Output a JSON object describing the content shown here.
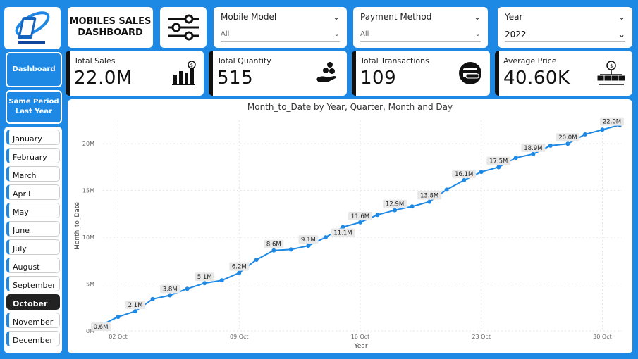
{
  "title": {
    "line1": "MOBILES SALES",
    "line2": "DASHBOARD"
  },
  "filters": [
    {
      "label": "Mobile Model",
      "value": "All"
    },
    {
      "label": "Payment Method",
      "value": "All"
    },
    {
      "label": "Year",
      "value": "2022"
    }
  ],
  "nav": {
    "dashboard": "Dashboard",
    "same_period_1": "Same Period",
    "same_period_2": "Last Year"
  },
  "kpis": [
    {
      "label": "Total Sales",
      "value": "22.0M",
      "icon": "bar-chart-dollar-icon"
    },
    {
      "label": "Total Quantity",
      "value": "515",
      "icon": "hand-coins-icon"
    },
    {
      "label": "Total Transactions",
      "value": "109",
      "icon": "card-payment-icon"
    },
    {
      "label": "Average Price",
      "value": "40.60K",
      "icon": "money-network-icon"
    }
  ],
  "months": [
    "January",
    "February",
    "March",
    "April",
    "May",
    "June",
    "July",
    "August",
    "September",
    "October",
    "November",
    "December"
  ],
  "selected_month": "October",
  "colors": {
    "accent": "#1E88E5",
    "line": "#1E88E5",
    "selected": "#222222"
  },
  "chart_data": {
    "type": "line",
    "title": "Month_to_Date by Year, Quarter, Month and Day",
    "xlabel": "Year",
    "ylabel": "Month_to_Date",
    "x_ticks": [
      "02 Oct",
      "09 Oct",
      "16 Oct",
      "23 Oct",
      "30 Oct"
    ],
    "y_ticks": [
      "0M",
      "5M",
      "10M",
      "15M",
      "20M"
    ],
    "ylim": [
      0,
      22.5
    ],
    "x_range": [
      "01 Oct",
      "31 Oct"
    ],
    "grid": true,
    "series": [
      {
        "days": [
          1,
          2,
          3,
          4,
          5,
          6,
          7,
          8,
          9,
          10,
          11,
          12,
          13,
          14,
          15,
          16,
          17,
          18,
          19,
          20,
          21,
          22,
          23,
          24,
          25,
          26,
          27,
          28,
          29,
          30,
          31
        ],
        "values": [
          0.6,
          1.5,
          2.1,
          3.4,
          3.8,
          4.5,
          5.1,
          5.4,
          6.2,
          7.6,
          8.6,
          8.7,
          9.1,
          10.0,
          11.1,
          11.6,
          12.4,
          12.9,
          13.3,
          13.8,
          15.1,
          16.1,
          17.0,
          17.5,
          18.5,
          18.9,
          19.8,
          20.0,
          21.0,
          21.5,
          22.0
        ],
        "data_labels": [
          {
            "day": 1,
            "text": "0.6M"
          },
          {
            "day": 3,
            "text": "2.1M"
          },
          {
            "day": 5,
            "text": "3.8M"
          },
          {
            "day": 7,
            "text": "5.1M"
          },
          {
            "day": 9,
            "text": "6.2M"
          },
          {
            "day": 11,
            "text": "8.6M"
          },
          {
            "day": 13,
            "text": "9.1M"
          },
          {
            "day": 15,
            "text": "11.1M"
          },
          {
            "day": 16,
            "text": "11.6M"
          },
          {
            "day": 18,
            "text": "12.9M"
          },
          {
            "day": 20,
            "text": "13.8M"
          },
          {
            "day": 22,
            "text": "16.1M"
          },
          {
            "day": 24,
            "text": "17.5M"
          },
          {
            "day": 26,
            "text": "18.9M"
          },
          {
            "day": 28,
            "text": "20.0M"
          },
          {
            "day": 31,
            "text": "22.0M"
          }
        ]
      }
    ]
  }
}
